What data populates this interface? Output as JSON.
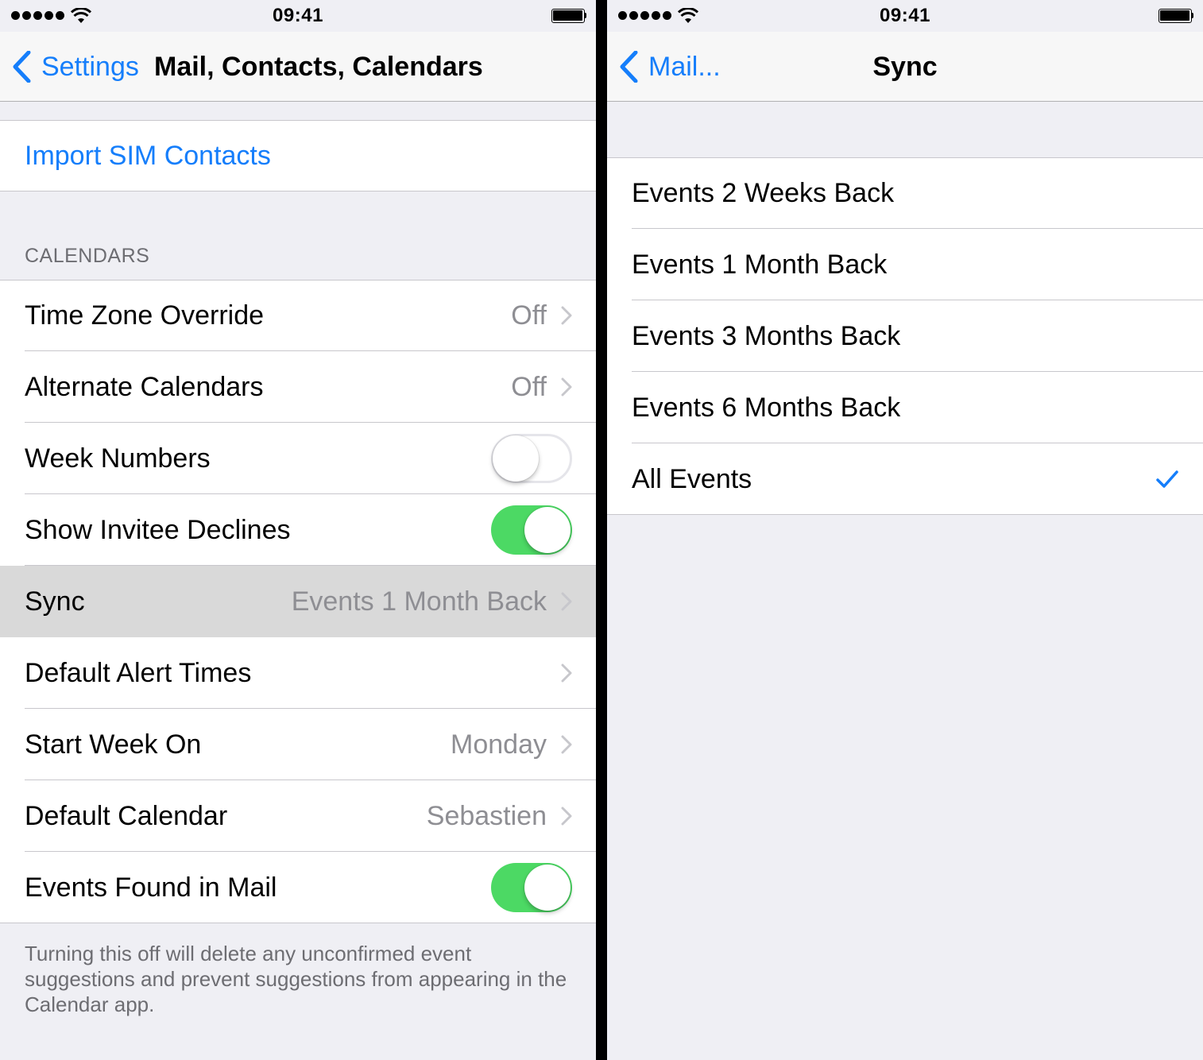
{
  "status": {
    "time": "09:41"
  },
  "left": {
    "nav": {
      "back_label": "Settings",
      "title": "Mail, Contacts, Calendars"
    },
    "import_sim": "Import SIM Contacts",
    "section_header": "CALENDARS",
    "rows": [
      {
        "label": "Time Zone Override",
        "value": "Off"
      },
      {
        "label": "Alternate Calendars",
        "value": "Off"
      },
      {
        "label": "Week Numbers",
        "toggle": "off"
      },
      {
        "label": "Show Invitee Declines",
        "toggle": "on"
      },
      {
        "label": "Sync",
        "value": "Events 1 Month Back"
      },
      {
        "label": "Default Alert Times",
        "value": ""
      },
      {
        "label": "Start Week On",
        "value": "Monday"
      },
      {
        "label": "Default Calendar",
        "value": "Sebastien"
      },
      {
        "label": "Events Found in Mail",
        "toggle": "on"
      }
    ],
    "footer": "Turning this off will delete any unconfirmed event suggestions and prevent suggestions from appearing in the Calendar app."
  },
  "right": {
    "nav": {
      "back_label": "Mail...",
      "title": "Sync"
    },
    "options": [
      {
        "label": "Events 2 Weeks Back",
        "selected": false
      },
      {
        "label": "Events 1 Month Back",
        "selected": false
      },
      {
        "label": "Events 3 Months Back",
        "selected": false
      },
      {
        "label": "Events 6 Months Back",
        "selected": false
      },
      {
        "label": "All Events",
        "selected": true
      }
    ]
  },
  "colors": {
    "accent": "#157efb",
    "toggle_on": "#4cd964",
    "background": "#efeff4"
  },
  "icons": [
    "signal-icon",
    "wifi-icon",
    "battery-icon",
    "chevron-left-icon",
    "chevron-right-icon",
    "checkmark-icon"
  ]
}
